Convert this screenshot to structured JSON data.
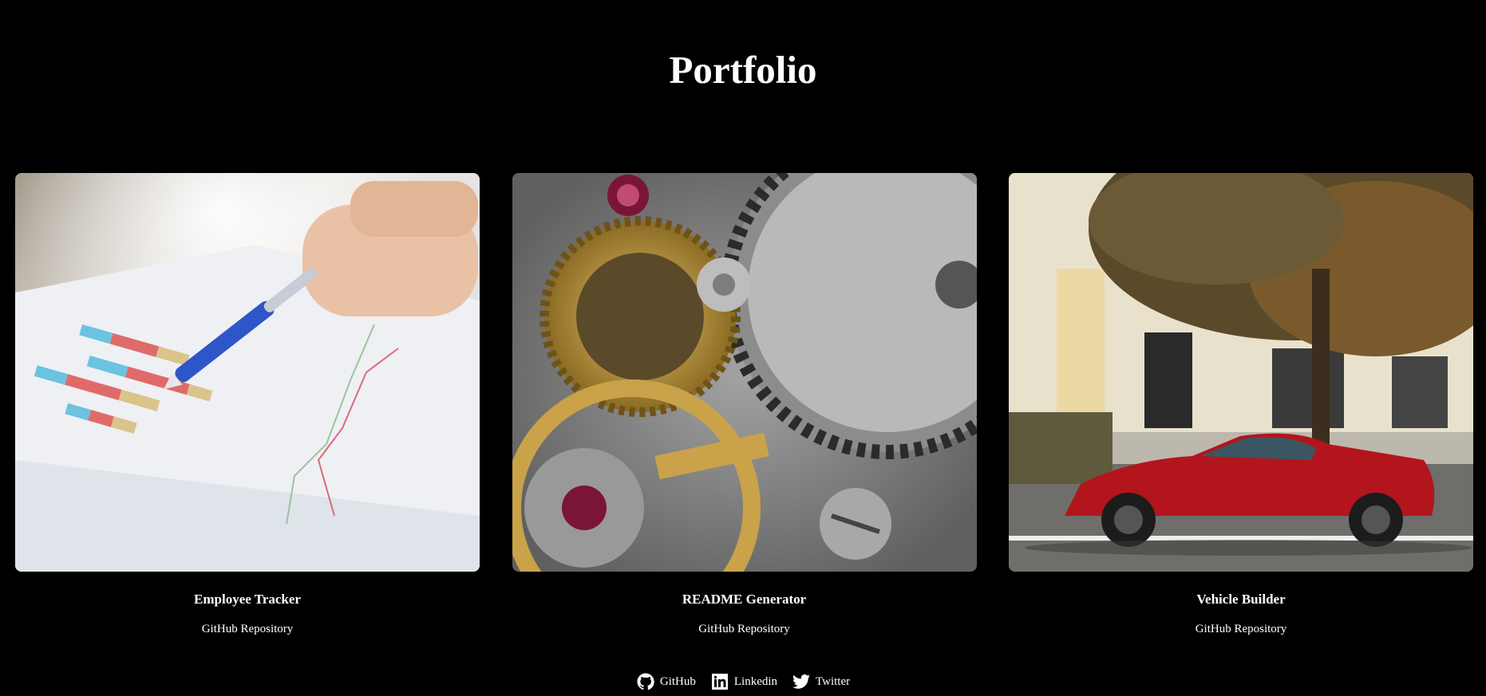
{
  "page": {
    "title": "Portfolio"
  },
  "projects": [
    {
      "title": "Employee Tracker",
      "link_label": "GitHub Repository",
      "image": "chart-analysis-photo"
    },
    {
      "title": "README Generator",
      "link_label": "GitHub Repository",
      "image": "watch-gears-photo"
    },
    {
      "title": "Vehicle Builder",
      "link_label": "GitHub Repository",
      "image": "red-car-photo"
    }
  ],
  "footer": {
    "links": [
      {
        "label": "GitHub",
        "icon": "github-icon"
      },
      {
        "label": "Linkedin",
        "icon": "linkedin-icon"
      },
      {
        "label": "Twitter",
        "icon": "twitter-icon"
      }
    ]
  },
  "colors": {
    "background": "#000000",
    "text": "#ffffff"
  }
}
